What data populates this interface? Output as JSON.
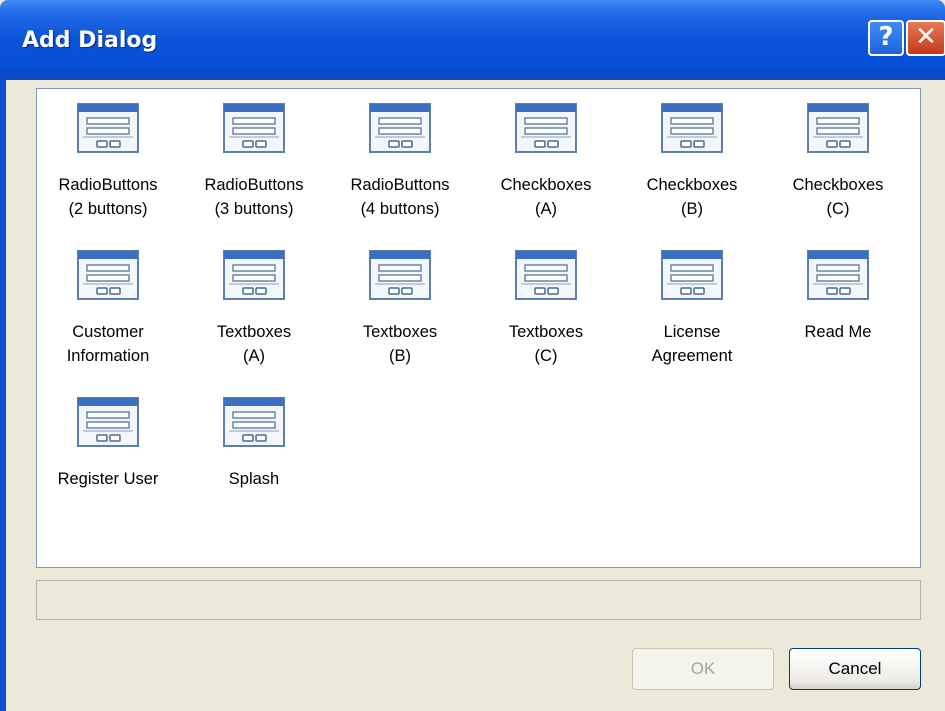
{
  "window": {
    "title": "Add Dialog"
  },
  "titlebar": {
    "help_label": "?",
    "close_label": "✕"
  },
  "dialogs": [
    {
      "label": "RadioButtons\n(2 buttons)",
      "icon": "dialog-template-icon"
    },
    {
      "label": "RadioButtons\n(3 buttons)",
      "icon": "dialog-template-icon"
    },
    {
      "label": "RadioButtons\n(4 buttons)",
      "icon": "dialog-template-icon"
    },
    {
      "label": "Checkboxes\n(A)",
      "icon": "dialog-template-icon"
    },
    {
      "label": "Checkboxes\n(B)",
      "icon": "dialog-template-icon"
    },
    {
      "label": "Checkboxes\n(C)",
      "icon": "dialog-template-icon"
    },
    {
      "label": "Customer\nInformation",
      "icon": "dialog-template-icon"
    },
    {
      "label": "Textboxes\n(A)",
      "icon": "dialog-template-icon"
    },
    {
      "label": "Textboxes\n(B)",
      "icon": "dialog-template-icon"
    },
    {
      "label": "Textboxes\n(C)",
      "icon": "dialog-template-icon"
    },
    {
      "label": "License\nAgreement",
      "icon": "dialog-template-icon"
    },
    {
      "label": "Read Me",
      "icon": "dialog-template-icon"
    },
    {
      "label": "Register User",
      "icon": "dialog-template-icon"
    },
    {
      "label": "Splash",
      "icon": "dialog-template-icon"
    }
  ],
  "status": {
    "text": ""
  },
  "buttons": {
    "ok_label": "OK",
    "cancel_label": "Cancel",
    "ok_enabled": false
  },
  "colors": {
    "titlebar": "#0a54da",
    "face": "#ece9d8",
    "list_bg": "#ffffff"
  }
}
